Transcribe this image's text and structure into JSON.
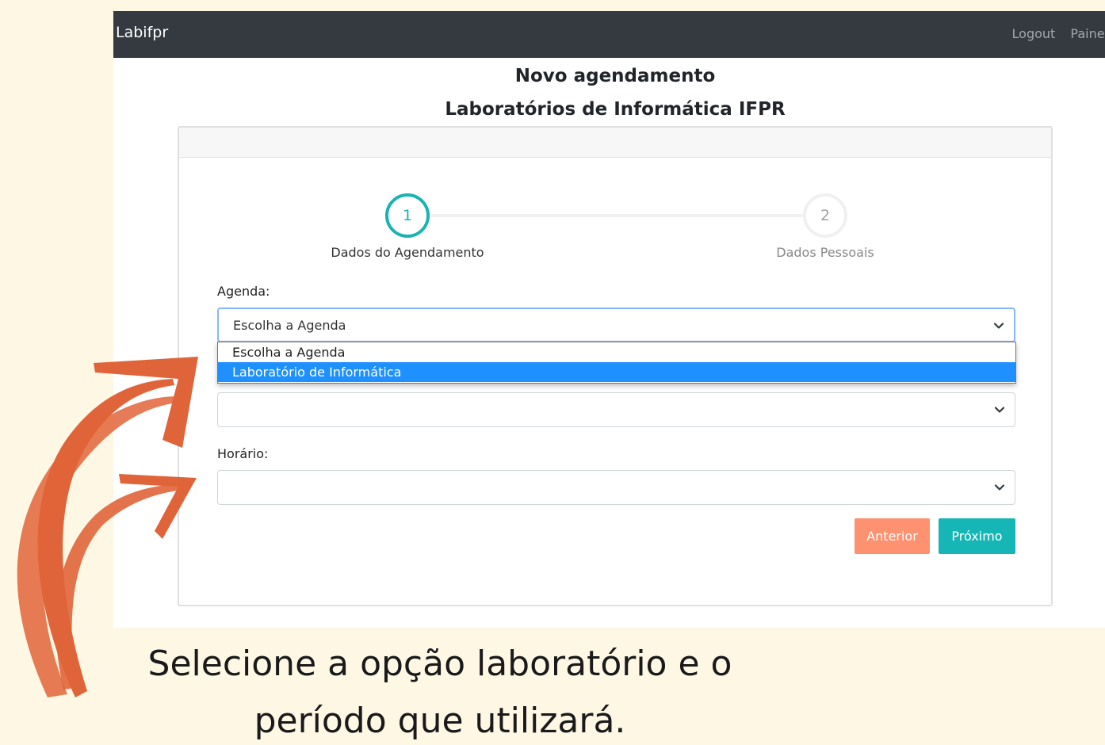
{
  "navbar": {
    "brand": "Labifpr",
    "links": [
      "Logout",
      "Painel"
    ]
  },
  "header": {
    "title": "Novo agendamento",
    "subtitle": "Laboratórios de Informática IFPR"
  },
  "stepper": {
    "steps": [
      {
        "number": "1",
        "label": "Dados do Agendamento",
        "active": true
      },
      {
        "number": "2",
        "label": "Dados Pessoais",
        "active": false
      }
    ]
  },
  "form": {
    "agenda": {
      "label": "Agenda:",
      "value": "Escolha a Agenda",
      "options": [
        "Escolha a Agenda",
        "Laboratório de Informática"
      ],
      "highlighted_option": "Laboratório de Informática"
    },
    "second_select": {
      "value": ""
    },
    "horario": {
      "label": "Horário:",
      "value": ""
    }
  },
  "buttons": {
    "prev_label": "Anterior",
    "next_label": "Próximo"
  },
  "caption": {
    "line1": "Selecione a opção laboratório e o",
    "line2": "período que utilizará."
  },
  "colors": {
    "page_background": "#fef7e4",
    "navbar": "#343a40",
    "accent_teal": "#17b6b6",
    "button_orange": "#fd9170",
    "highlight_blue": "#1e90ff",
    "arrow_orange": "#e0643a"
  }
}
